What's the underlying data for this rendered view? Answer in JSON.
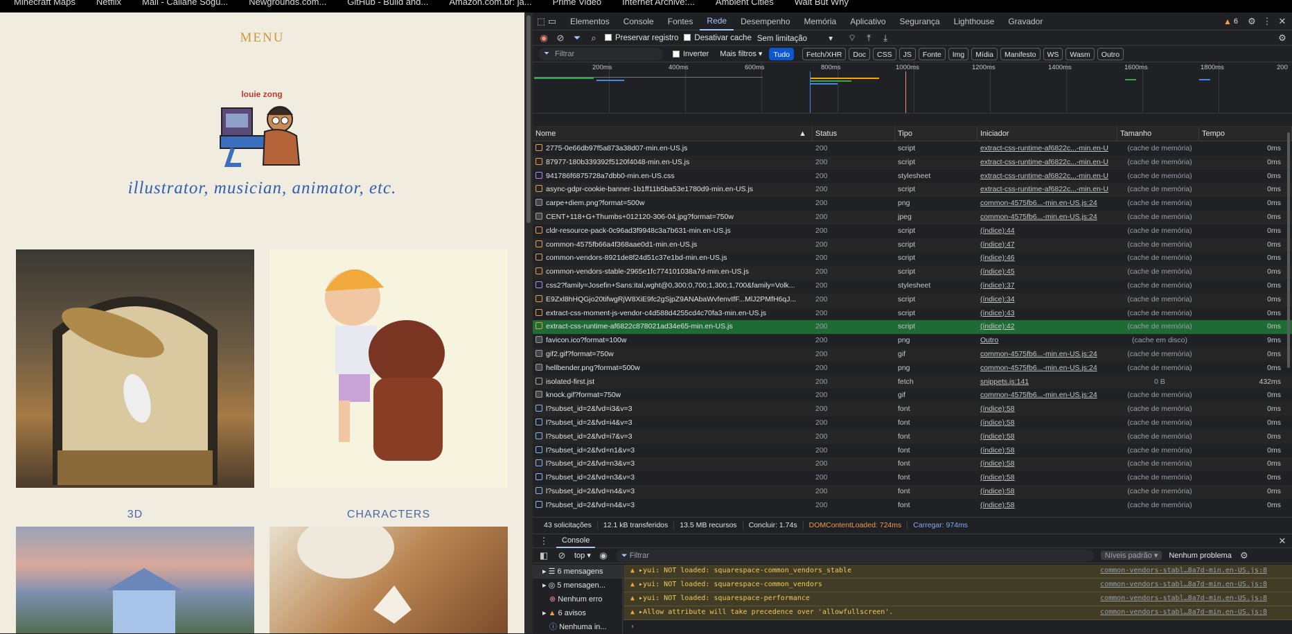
{
  "bookmarks": [
    "Minecraft Maps",
    "Netflix",
    "Mail - Caliane Sogu...",
    "Newgrounds.com...",
    "GitHub - Build and...",
    "Amazon.com.br: ja...",
    "Prime Video",
    "Internet Archive:...",
    "Ambient Cities",
    "Wait But Why"
  ],
  "site": {
    "menu": "MENU",
    "tagline": "illustrator, musician, animator, etc.",
    "caption_3d": "3D",
    "caption_characters": "CHARACTERS"
  },
  "devtools": {
    "tabs": [
      "Elementos",
      "Console",
      "Fontes",
      "Rede",
      "Desempenho",
      "Memória",
      "Aplicativo",
      "Segurança",
      "Lighthouse",
      "Gravador"
    ],
    "active_tab": "Rede",
    "warning_count": "6",
    "preserve_log": "Preservar registro",
    "disable_cache": "Desativar cache",
    "throttle": "Sem limitação",
    "filter_placeholder": "Filtrar",
    "invert": "Inverter",
    "more_filters": "Mais filtros",
    "chips": [
      "Tudo",
      "Fetch/XHR",
      "Doc",
      "CSS",
      "JS",
      "Fonte",
      "Img",
      "Mídia",
      "Manifesto",
      "WS",
      "Wasm",
      "Outro"
    ],
    "timeline_ticks": [
      "200ms",
      "400ms",
      "600ms",
      "800ms",
      "1000ms",
      "1200ms",
      "1400ms",
      "1600ms",
      "1800ms",
      "200"
    ],
    "columns": [
      "Nome",
      "Status",
      "Tipo",
      "Iniciador",
      "Tamanho",
      "Tempo"
    ],
    "rows": [
      {
        "name": "2775-0e66db97f5a873a38d07-min.en-US.js",
        "status": "200",
        "type": "script",
        "initiator": "extract-css-runtime-af6822c...-min.en-U",
        "size": "(cache de memória)",
        "time": "0ms",
        "icon": "js-file-icon"
      },
      {
        "name": "87977-180b339392f5120f4048-min.en-US.js",
        "status": "200",
        "type": "script",
        "initiator": "extract-css-runtime-af6822c...-min.en-U",
        "size": "(cache de memória)",
        "time": "0ms",
        "icon": "js-file-icon"
      },
      {
        "name": "941786f6875728a7dbb0-min.en-US.css",
        "status": "200",
        "type": "stylesheet",
        "initiator": "extract-css-runtime-af6822c...-min.en-U",
        "size": "(cache de memória)",
        "time": "0ms",
        "icon": "css-file-icon"
      },
      {
        "name": "async-gdpr-cookie-banner-1b1ff11b5ba53e1780d9-min.en-US.js",
        "status": "200",
        "type": "script",
        "initiator": "extract-css-runtime-af6822c...-min.en-U",
        "size": "(cache de memória)",
        "time": "0ms",
        "icon": "js-file-icon"
      },
      {
        "name": "carpe+diem.png?format=500w",
        "status": "200",
        "type": "png",
        "initiator": "common-4575fb6...-min.en-US.js:24",
        "size": "(cache de memória)",
        "time": "0ms",
        "icon": "image-file-icon"
      },
      {
        "name": "CENT+118+G+Thumbs+012120-306-04.jpg?format=750w",
        "status": "200",
        "type": "jpeg",
        "initiator": "common-4575fb6...-min.en-US.js:24",
        "size": "(cache de memória)",
        "time": "0ms",
        "icon": "image-file-icon"
      },
      {
        "name": "cldr-resource-pack-0c96ad3f9948c3a7b631-min.en-US.js",
        "status": "200",
        "type": "script",
        "initiator": "(índice):44",
        "size": "(cache de memória)",
        "time": "0ms",
        "icon": "js-file-icon"
      },
      {
        "name": "common-4575fb66a4f368aae0d1-min.en-US.js",
        "status": "200",
        "type": "script",
        "initiator": "(índice):47",
        "size": "(cache de memória)",
        "time": "0ms",
        "icon": "js-file-icon"
      },
      {
        "name": "common-vendors-8921de8f24d51c37e1bd-min.en-US.js",
        "status": "200",
        "type": "script",
        "initiator": "(índice):46",
        "size": "(cache de memória)",
        "time": "0ms",
        "icon": "js-file-icon"
      },
      {
        "name": "common-vendors-stable-2965e1fc774101038a7d-min.en-US.js",
        "status": "200",
        "type": "script",
        "initiator": "(índice):45",
        "size": "(cache de memória)",
        "time": "0ms",
        "icon": "js-file-icon"
      },
      {
        "name": "css2?family=Josefin+Sans:ital,wght@0,300;0,700;1,300;1,700&family=Volk...",
        "status": "200",
        "type": "stylesheet",
        "initiator": "(índice):37",
        "size": "(cache de memória)",
        "time": "0ms",
        "icon": "css-file-icon"
      },
      {
        "name": "E9Zxl8hHQGjo20tifwgRjW8XiE9fc2gSjpZ9ANAbaWvfenvIfF...MlJ2PMfH6qJ...",
        "status": "200",
        "type": "script",
        "initiator": "(índice):34",
        "size": "(cache de memória)",
        "time": "0ms",
        "icon": "js-file-icon"
      },
      {
        "name": "extract-css-moment-js-vendor-c4d588d4255cd4c70fa3-min.en-US.js",
        "status": "200",
        "type": "script",
        "initiator": "(índice):43",
        "size": "(cache de memória)",
        "time": "0ms",
        "icon": "js-file-icon"
      },
      {
        "name": "extract-css-runtime-af6822c878021ad34e65-min.en-US.js",
        "status": "200",
        "type": "script",
        "initiator": "(índice):42",
        "size": "(cache de memória)",
        "time": "0ms",
        "icon": "js-file-icon"
      },
      {
        "name": "favicon.ico?format=100w",
        "status": "200",
        "type": "png",
        "initiator": "Outro",
        "size": "(cache em disco)",
        "time": "9ms",
        "icon": "image-file-icon"
      },
      {
        "name": "gif2.gif?format=750w",
        "status": "200",
        "type": "gif",
        "initiator": "common-4575fb6...-min.en-US.js:24",
        "size": "(cache de memória)",
        "time": "0ms",
        "icon": "image-file-icon"
      },
      {
        "name": "hellbender.png?format=500w",
        "status": "200",
        "type": "png",
        "initiator": "common-4575fb6...-min.en-US.js:24",
        "size": "(cache de memória)",
        "time": "0ms",
        "icon": "image-file-icon"
      },
      {
        "name": "isolated-first.jst",
        "status": "200",
        "type": "fetch",
        "initiator": "snippets.js:141",
        "size": "0 B",
        "time": "432ms",
        "icon": "fetch-file-icon"
      },
      {
        "name": "knock.gif?format=750w",
        "status": "200",
        "type": "gif",
        "initiator": "common-4575fb6...-min.en-US.js:24",
        "size": "(cache de memória)",
        "time": "0ms",
        "icon": "image-file-icon"
      },
      {
        "name": "l?subset_id=2&fvd=i3&v=3",
        "status": "200",
        "type": "font",
        "initiator": "(índice):58",
        "size": "(cache de memória)",
        "time": "0ms",
        "icon": "font-file-icon"
      },
      {
        "name": "l?subset_id=2&fvd=i4&v=3",
        "status": "200",
        "type": "font",
        "initiator": "(índice):58",
        "size": "(cache de memória)",
        "time": "0ms",
        "icon": "font-file-icon"
      },
      {
        "name": "l?subset_id=2&fvd=i7&v=3",
        "status": "200",
        "type": "font",
        "initiator": "(índice):58",
        "size": "(cache de memória)",
        "time": "0ms",
        "icon": "font-file-icon"
      },
      {
        "name": "l?subset_id=2&fvd=n1&v=3",
        "status": "200",
        "type": "font",
        "initiator": "(índice):58",
        "size": "(cache de memória)",
        "time": "0ms",
        "icon": "font-file-icon"
      },
      {
        "name": "l?subset_id=2&fvd=n3&v=3",
        "status": "200",
        "type": "font",
        "initiator": "(índice):58",
        "size": "(cache de memória)",
        "time": "0ms",
        "icon": "font-file-icon"
      },
      {
        "name": "l?subset_id=2&fvd=n3&v=3",
        "status": "200",
        "type": "font",
        "initiator": "(índice):58",
        "size": "(cache de memória)",
        "time": "0ms",
        "icon": "font-file-icon"
      },
      {
        "name": "l?subset_id=2&fvd=n4&v=3",
        "status": "200",
        "type": "font",
        "initiator": "(índice):58",
        "size": "(cache de memória)",
        "time": "0ms",
        "icon": "font-file-icon"
      },
      {
        "name": "l?subset_id=2&fvd=n4&v=3",
        "status": "200",
        "type": "font",
        "initiator": "(índice):58",
        "size": "(cache de memória)",
        "time": "0ms",
        "icon": "font-file-icon"
      }
    ],
    "selected_row": "extract-css-runtime-af6822c878021ad34e65-min.en-US.js",
    "summary": {
      "requests": "43 solicitações",
      "transferred": "12.1 kB transferidos",
      "resources": "13.5 MB recursos",
      "finish": "Concluir: 1.74s",
      "dcl": "DOMContentLoaded: 724ms",
      "load": "Carregar: 974ms"
    },
    "console": {
      "tab": "Console",
      "context": "top",
      "filter_placeholder": "Filtrar",
      "levels": "Níveis padrão",
      "issues": "Nenhum problema",
      "sidebar": [
        "6 mensagens",
        "5 mensagen...",
        "Nenhum erro",
        "6 avisos",
        "Nenhuma in..."
      ],
      "messages": [
        {
          "text": "▸yui: NOT loaded: squarespace-common_vendors_stable",
          "source": "common-vendors-stabl…8a7d-min.en-US.js:8"
        },
        {
          "text": "▸yui: NOT loaded: squarespace-common_vendors",
          "source": "common-vendors-stabl…8a7d-min.en-US.js:8"
        },
        {
          "text": "▸yui: NOT loaded: squarespace-performance",
          "source": "common-vendors-stabl…8a7d-min.en-US.js:8"
        },
        {
          "text": "▸Allow attribute will take precedence over 'allowfullscreen'.",
          "source": "common-vendors-stabl…8a7d-min.en-US.js:8"
        }
      ]
    }
  }
}
